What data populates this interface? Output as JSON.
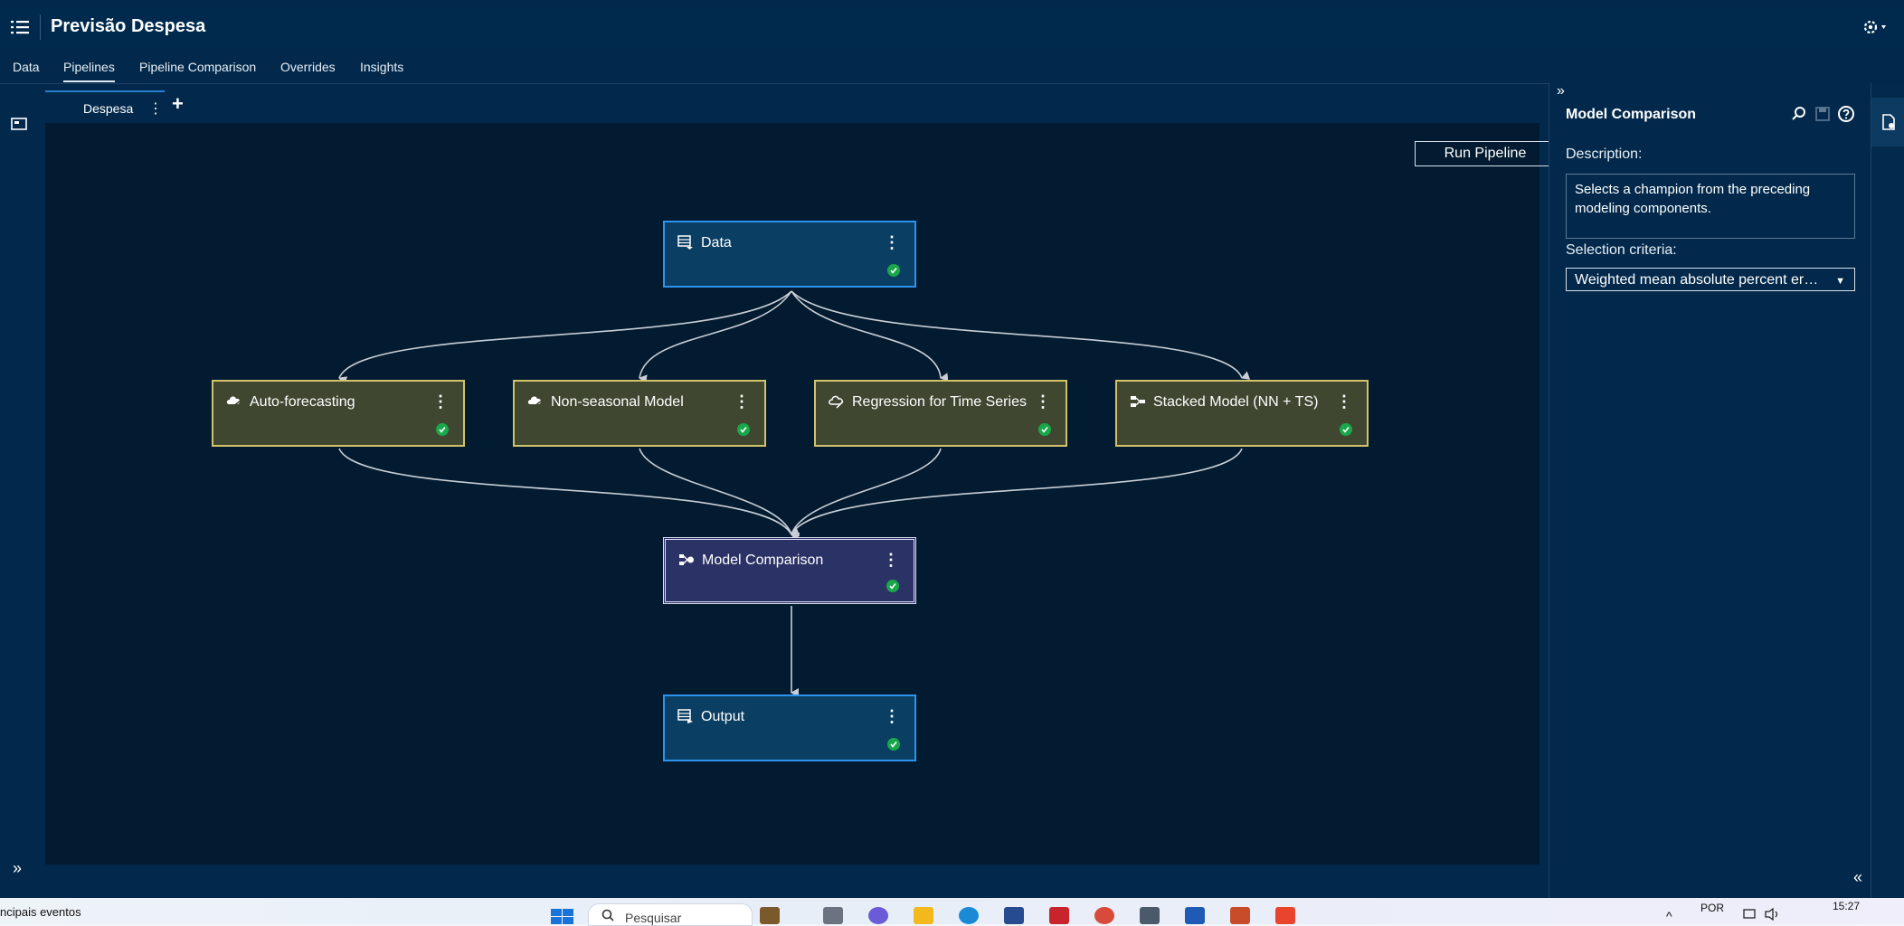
{
  "app": {
    "title": "Previsão Despesa"
  },
  "tabs": [
    {
      "label": "Data"
    },
    {
      "label": "Pipelines"
    },
    {
      "label": "Pipeline Comparison"
    },
    {
      "label": "Overrides"
    },
    {
      "label": "Insights"
    }
  ],
  "active_tab": "Pipelines",
  "pipeline_tab": {
    "label": "Despesa",
    "more": "⋮",
    "add": "+"
  },
  "canvas": {
    "run_button": "Run Pipeline"
  },
  "nodes": {
    "data": {
      "label": "Data",
      "more": "⋮",
      "status": "completed",
      "icon": "data-table-icon"
    },
    "auto_forecasting": {
      "label": "Auto-forecasting",
      "more": "⋮",
      "status": "completed",
      "icon": "forecast-cloud-icon"
    },
    "non_seasonal": {
      "label": "Non-seasonal Model",
      "more": "⋮",
      "status": "completed",
      "icon": "forecast-cloud-icon"
    },
    "regression_ts": {
      "label": "Regression for Time Series",
      "more": "⋮",
      "status": "completed",
      "icon": "regression-cloud-icon"
    },
    "stacked_model": {
      "label": "Stacked Model (NN + TS)",
      "more": "⋮",
      "status": "completed",
      "icon": "stacked-model-icon"
    },
    "model_comparison": {
      "label": "Model Comparison",
      "more": "⋮",
      "status": "completed",
      "icon": "model-comparison-icon"
    },
    "output": {
      "label": "Output",
      "more": "⋮",
      "status": "completed",
      "icon": "output-table-icon"
    }
  },
  "right_panel": {
    "collapse": "»",
    "title": "Model Comparison",
    "description_label": "Description:",
    "description": "Selects a champion from the preceding modeling components.",
    "selection_label": "Selection criteria:",
    "selection_value": "Weighted mean absolute percent er…",
    "icons": [
      "search-icon",
      "save-icon",
      "help-icon"
    ]
  },
  "left_bar": {
    "expand": "»"
  },
  "right_bottom": {
    "expand": "«"
  },
  "taskbar": {
    "news": "ncipais eventos",
    "search_placeholder": "Pesquisar",
    "language": "POR",
    "time": "15:27",
    "caret": "^"
  },
  "colors": {
    "app_bg": "#02294b",
    "canvas_bg": "#021b30",
    "node_blue": "#0a3e62",
    "node_blue_border": "#2d93ee",
    "node_olive": "#3f4731",
    "node_olive_border": "#d3c26a",
    "node_purple": "#2b3265",
    "status_green": "#18a84a"
  }
}
